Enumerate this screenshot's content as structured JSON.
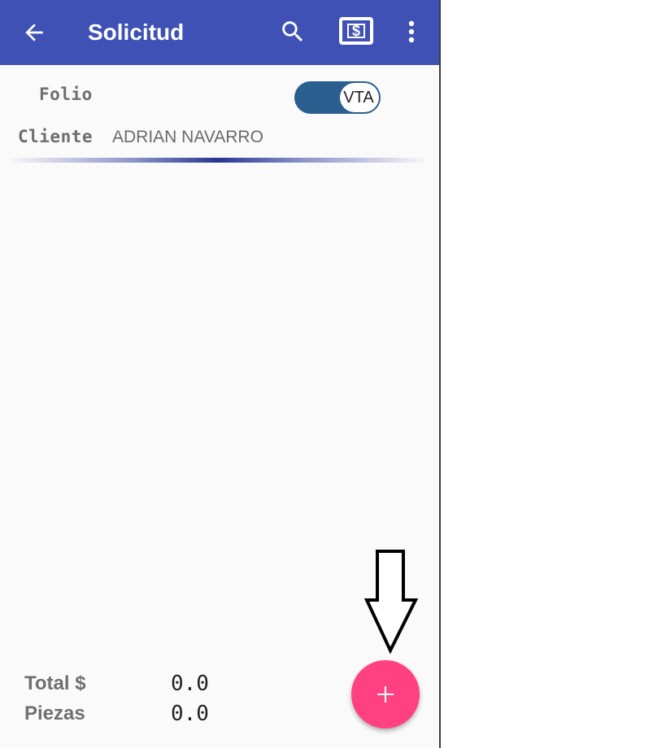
{
  "appbar": {
    "title": "Solicitud",
    "back_icon": "arrow-back-icon",
    "search_icon": "search-icon",
    "money_icon": "money-icon",
    "more_icon": "more-vert-icon",
    "color": "#3f51b5"
  },
  "form": {
    "folio_label": "Folio",
    "cliente_label": "Cliente",
    "cliente_value": "ADRIAN NAVARRO",
    "toggle": {
      "label": "VTA",
      "checked": true,
      "track_color": "#2a5f8f"
    }
  },
  "summary": {
    "total_label": "Total $",
    "total_value": "0.0",
    "piezas_label": "Piezas",
    "piezas_value": "0.0"
  },
  "fab": {
    "icon": "plus-icon",
    "color": "#ff4081"
  },
  "annotation": {
    "icon": "down-arrow-annotation-icon"
  }
}
